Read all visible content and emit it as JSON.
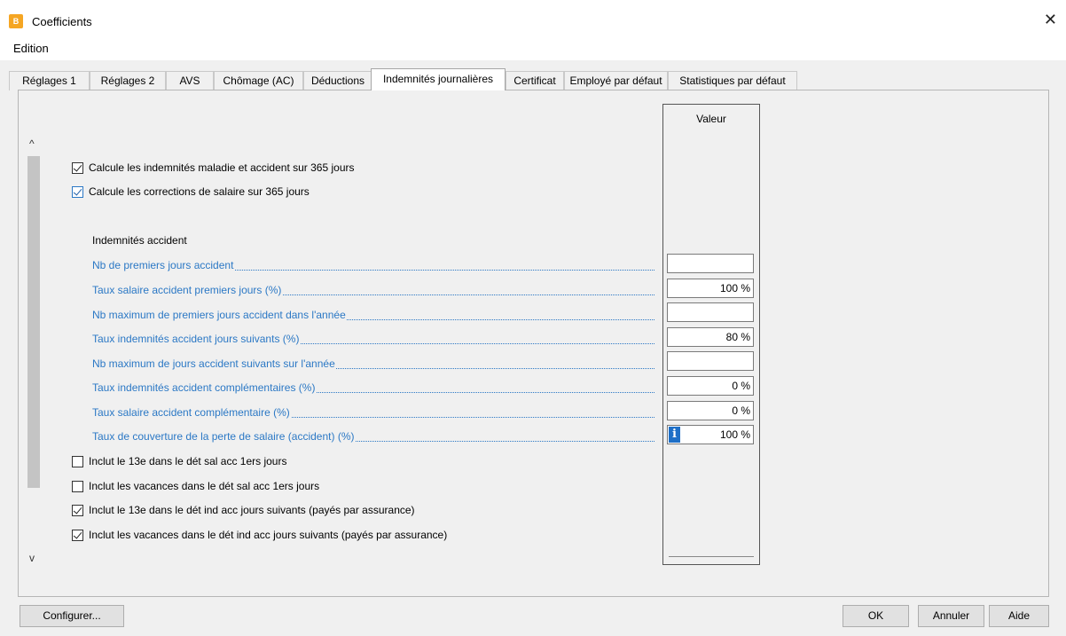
{
  "window": {
    "title": "Coefficients",
    "close_glyph": "✕"
  },
  "menu": {
    "edition": "Edition"
  },
  "tabs": [
    {
      "label": "Réglages 1"
    },
    {
      "label": "Réglages 2"
    },
    {
      "label": "AVS"
    },
    {
      "label": "Chômage (AC)"
    },
    {
      "label": "Déductions"
    },
    {
      "label": "Indemnités journalières",
      "active": true
    },
    {
      "label": "Certificat"
    },
    {
      "label": "Employé par défaut"
    },
    {
      "label": "Statistiques par défaut"
    }
  ],
  "scroll": {
    "up": "^",
    "down": "v"
  },
  "top_checks": [
    {
      "label": "Calcule les indemnités maladie et accident sur 365 jours",
      "checked": true
    },
    {
      "label": "Calcule les corrections de salaire sur 365 jours",
      "checked": true
    }
  ],
  "section_title": "Indemnités accident",
  "value_header": "Valeur",
  "fields": [
    {
      "label": "Nb de premiers jours accident",
      "value": ""
    },
    {
      "label": "Taux salaire accident premiers jours (%)",
      "value": "100 %"
    },
    {
      "label": "Nb maximum de premiers jours accident dans l'année",
      "value": ""
    },
    {
      "label": "Taux indemnités accident jours suivants (%)",
      "value": "80 %"
    },
    {
      "label": "Nb maximum de jours accident suivants sur l'année",
      "value": ""
    },
    {
      "label": "Taux indemnités accident complémentaires (%)",
      "value": "0 %"
    },
    {
      "label": "Taux salaire accident complémentaire (%)",
      "value": "0 %"
    },
    {
      "label": "Taux de couverture de la perte de salaire (accident) (%)",
      "value": "100 %",
      "info_icon": "i"
    }
  ],
  "bottom_checks": [
    {
      "label": "Inclut le 13e dans le dét sal acc 1ers jours",
      "checked": false
    },
    {
      "label": "Inclut les vacances dans le dét sal acc 1ers jours",
      "checked": false
    },
    {
      "label": "Inclut le 13e dans le dét ind acc jours suivants (payés par assurance)",
      "checked": true
    },
    {
      "label": "Inclut les vacances dans le dét ind acc jours suivants (payés par assurance)",
      "checked": true
    }
  ],
  "buttons": {
    "configure": "Configurer...",
    "ok": "OK",
    "cancel": "Annuler",
    "help": "Aide"
  },
  "colors": {
    "link_label": "#2b78c5",
    "app_icon": "#f5a623",
    "info_icon": "#1e6fc7"
  }
}
